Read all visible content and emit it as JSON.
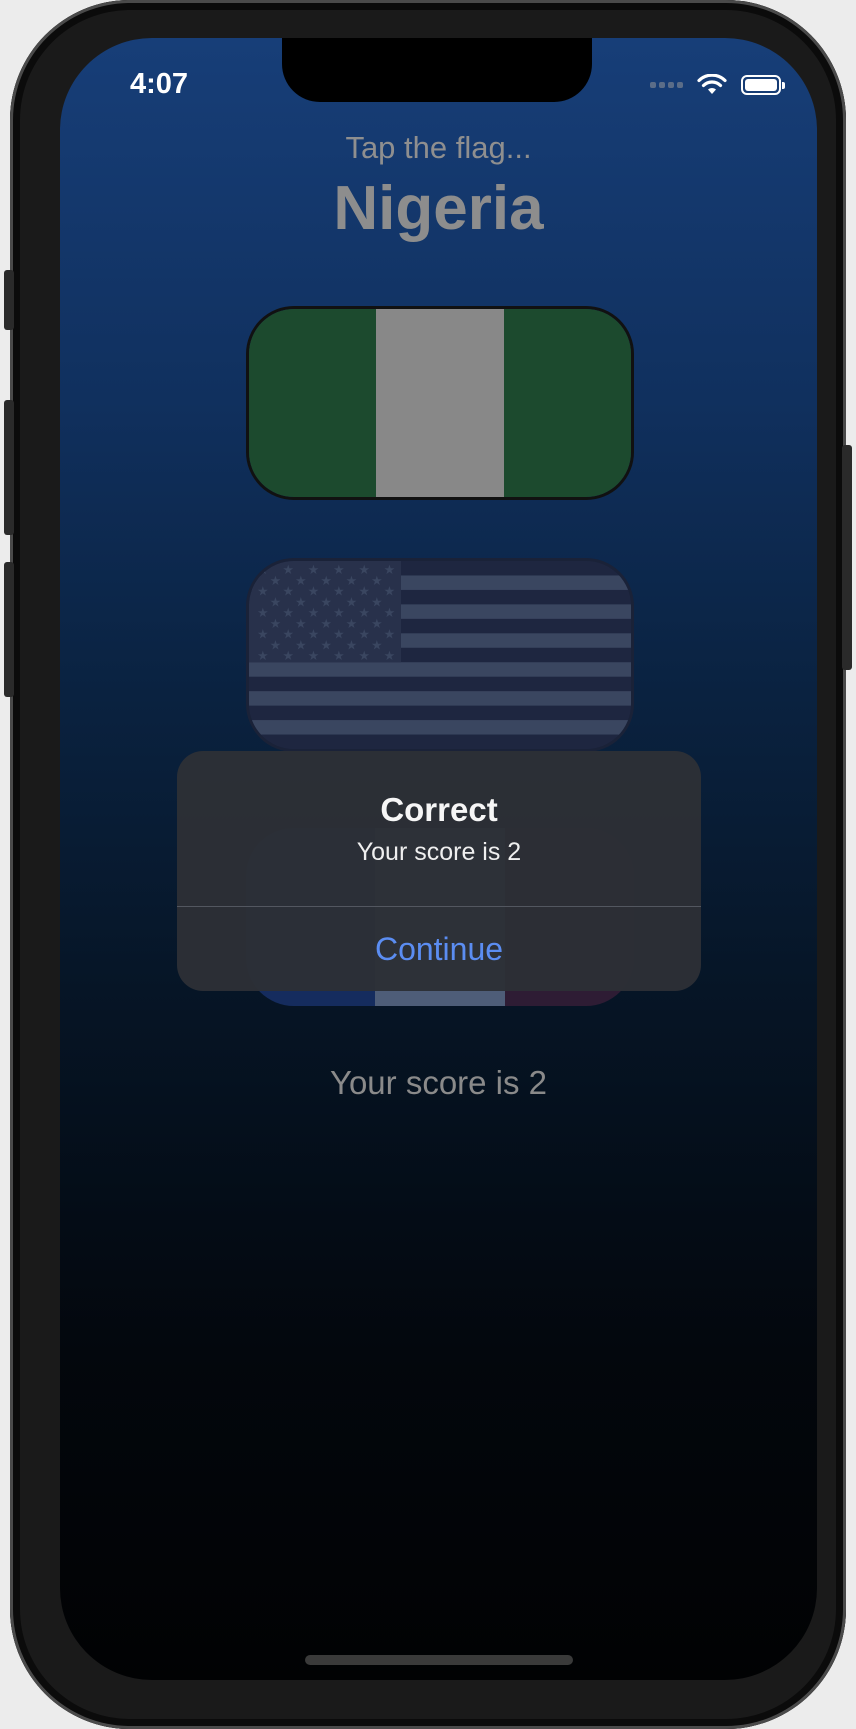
{
  "status_bar": {
    "time": "4:07",
    "signal_icon": "cellular-signal-icon",
    "wifi_icon": "wifi-icon",
    "battery_icon": "battery-icon",
    "battery_level": 1.0
  },
  "game": {
    "prompt": "Tap the flag...",
    "country": "Nigeria",
    "score_label": "Your score is 2",
    "flags": [
      {
        "country": "Nigeria",
        "colors": [
          "#1c4a2e",
          "#888888",
          "#1c4a2e"
        ]
      },
      {
        "country": "United States",
        "colors": [
          "#1e2640",
          "#3a4660",
          "#28314b"
        ]
      },
      {
        "country": "France",
        "colors": [
          "#152c5e",
          "#4e5d78",
          "#2e1c34"
        ]
      }
    ]
  },
  "alert": {
    "title": "Correct",
    "message": "Your score is 2",
    "button_label": "Continue",
    "button_color": "#5b8df2"
  },
  "colors": {
    "background_top": "#173e78",
    "background_bottom": "#010203"
  }
}
